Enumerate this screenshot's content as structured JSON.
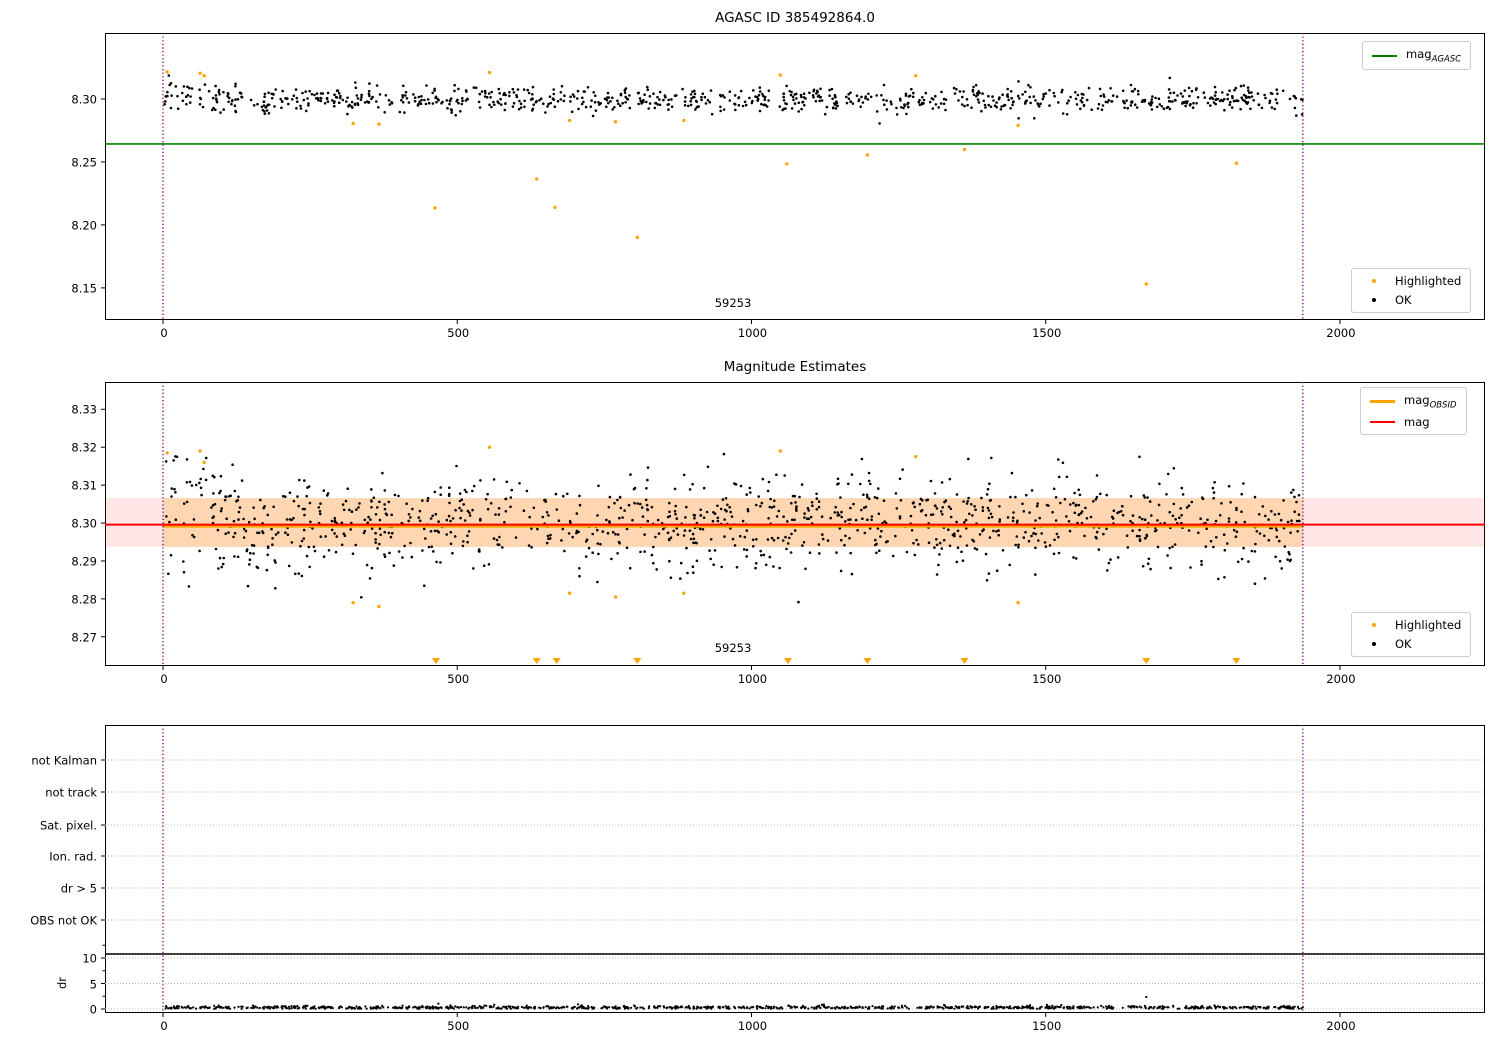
{
  "chart_data": [
    {
      "type": "scatter",
      "title": "AGASC ID 385492864.0",
      "xlim": [
        -98.6,
        2246.5
      ],
      "ylim": [
        8.1245,
        8.3524
      ],
      "xticks": [
        0,
        500,
        1000,
        1500,
        2000
      ],
      "yticks": [
        "8.30",
        "8.25",
        "8.20",
        "8.15"
      ],
      "ytick_values": [
        8.3,
        8.25,
        8.2,
        8.15
      ],
      "obsid": "59253",
      "obsid_x": 968,
      "vlines": [
        0,
        1937
      ],
      "vline_color": "#800080",
      "agasc_line": {
        "y": 8.2643,
        "color": "#008000",
        "legend_main": "mag",
        "legend_sub": "AGASC"
      },
      "ok": {
        "label": "OK",
        "color": "#000000",
        "n": 900,
        "x_range": [
          0,
          1937
        ],
        "mean": 8.2995,
        "std": 0.005,
        "clip": [
          8.277,
          8.3235
        ],
        "seed": 11
      },
      "highlighted": {
        "label": "Highlighted",
        "color": "#FFA500",
        "points": [
          [
            7,
            8.3215
          ],
          [
            63,
            8.3205
          ],
          [
            70,
            8.3185
          ],
          [
            323,
            8.2805
          ],
          [
            367,
            8.28
          ],
          [
            462,
            8.2135
          ],
          [
            555,
            8.321
          ],
          [
            635,
            8.2365
          ],
          [
            666,
            8.214
          ],
          [
            691,
            8.283
          ],
          [
            769,
            8.282
          ],
          [
            806,
            8.19
          ],
          [
            885,
            8.283
          ],
          [
            1049,
            8.319
          ],
          [
            1060,
            8.2485
          ],
          [
            1197,
            8.2555
          ],
          [
            1279,
            8.3185
          ],
          [
            1362,
            8.26
          ],
          [
            1453,
            8.279
          ],
          [
            1671,
            8.153
          ],
          [
            1824,
            8.249
          ]
        ]
      }
    },
    {
      "type": "scatter",
      "title": "Magnitude Estimates",
      "xlim": [
        -98.6,
        2246.5
      ],
      "ylim": [
        8.2623,
        8.3372
      ],
      "xticks": [
        0,
        500,
        1000,
        1500,
        2000
      ],
      "yticks": [
        "8.33",
        "8.32",
        "8.31",
        "8.30",
        "8.29",
        "8.28",
        "8.27"
      ],
      "ytick_values": [
        8.33,
        8.32,
        8.31,
        8.3,
        8.29,
        8.28,
        8.27
      ],
      "obsid": "59253",
      "obsid_x": 968,
      "vlines": [
        0,
        1937
      ],
      "vline_color": "#800080",
      "mag_line": {
        "y": 8.2996,
        "color": "#FF0000",
        "legend": "mag"
      },
      "obsid_line": {
        "y": 8.2991,
        "x_range": [
          0,
          1937
        ],
        "color": "#FFA500",
        "legend_main": "mag",
        "legend_sub": "OBSID"
      },
      "band": {
        "y_range": [
          8.2937,
          8.3066
        ],
        "color": "rgba(255,0,0,0.10)"
      },
      "obsid_band": {
        "y_range": [
          8.2937,
          8.3066
        ],
        "x_range": [
          0,
          1937
        ],
        "color": "rgba(255,165,0,0.22)"
      },
      "ok": {
        "label": "OK",
        "color": "#000000",
        "n": 1150,
        "x_range": [
          0,
          1937
        ],
        "mean": 8.3002,
        "std": 0.0058,
        "clip": [
          8.2765,
          8.3225
        ],
        "seed": 22
      },
      "highlighted": {
        "label": "Highlighted",
        "color": "#FFA500",
        "points": [
          [
            7,
            8.3185
          ],
          [
            63,
            8.319
          ],
          [
            70,
            8.316
          ],
          [
            323,
            8.279
          ],
          [
            367,
            8.278
          ],
          [
            555,
            8.32
          ],
          [
            691,
            8.2815
          ],
          [
            769,
            8.2805
          ],
          [
            885,
            8.2815
          ],
          [
            1049,
            8.319
          ],
          [
            1279,
            8.3175
          ],
          [
            1453,
            8.279
          ]
        ]
      },
      "clipped_low_markers": {
        "color": "#FFA500",
        "x": [
          464,
          635,
          669,
          806,
          1062,
          1197,
          1362,
          1671,
          1824
        ]
      }
    },
    {
      "type": "flags",
      "flag_categories": [
        "not Kalman",
        "not track",
        "Sat. pixel.",
        "Ion. rad.",
        "dr > 5",
        "OBS not OK"
      ],
      "ylabel": "dr",
      "dr_ticks": [
        10,
        5,
        0
      ],
      "dr_minor_ticks": [
        12.5,
        7.5,
        2.5
      ],
      "xticks": [
        0,
        500,
        1000,
        1500,
        2000
      ],
      "xlim": [
        -98.6,
        2246.5
      ],
      "vlines": [
        0,
        1937
      ],
      "vline_color": "#800080",
      "separator_line_color": "#000000",
      "grid_color": "#b8b8b8",
      "dr_points": {
        "color": "#000000",
        "n": 1000,
        "x_range": [
          0,
          1937
        ],
        "mean": 0.3,
        "std": 0.16,
        "min": 0.06,
        "max": 1.1,
        "seed": 33,
        "extra": [
          [
            468,
            1.05
          ],
          [
            563,
            0.85
          ],
          [
            705,
            0.92
          ],
          [
            1123,
            0.88
          ],
          [
            1502,
            0.8
          ],
          [
            1671,
            2.35
          ]
        ]
      }
    }
  ]
}
